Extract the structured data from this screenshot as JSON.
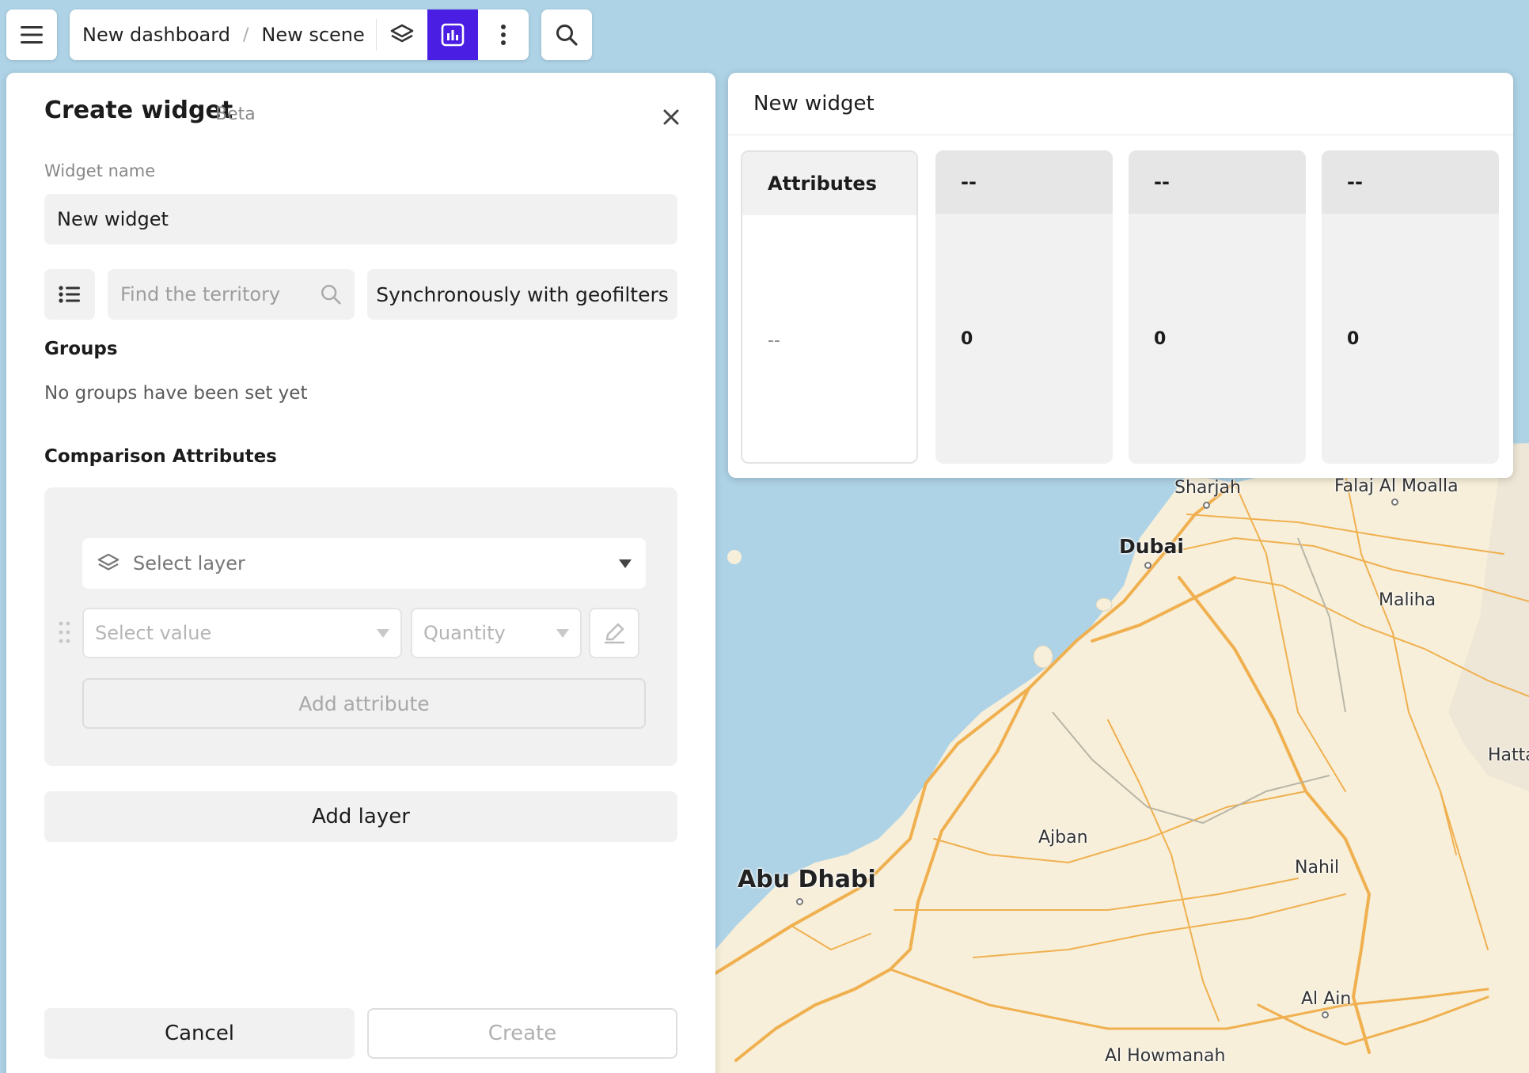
{
  "app": {
    "breadcrumb": {
      "dashboard": "New dashboard",
      "separator": "/",
      "scene": "New scene"
    },
    "accent_color": "#4b1ee3"
  },
  "icons": {
    "menu": "hamburger-menu-icon",
    "layers": "layers-icon",
    "widget": "chart-widget-icon",
    "more": "more-vertical-icon",
    "search": "search-icon",
    "close": "close-icon",
    "list": "list-icon",
    "edit": "pencil-icon",
    "drag": "drag-handle-icon"
  },
  "panel": {
    "title": "Create widget",
    "badge": "Beta",
    "widget_name_label": "Widget name",
    "widget_name_value": "New widget",
    "territory_placeholder": "Find the territory",
    "sync_button": "Synchronously with geofilters",
    "groups_title": "Groups",
    "groups_empty": "No groups have been set yet",
    "comparison_title": "Comparison Attributes",
    "layer_placeholder": "Select layer",
    "value_placeholder": "Select value",
    "quantity_placeholder": "Quantity",
    "add_attribute": "Add attribute",
    "add_layer": "Add layer",
    "cancel": "Cancel",
    "create": "Create"
  },
  "preview": {
    "title": "New widget",
    "columns": [
      {
        "header": "Attributes",
        "value": "--"
      },
      {
        "header": "--",
        "value": "0"
      },
      {
        "header": "--",
        "value": "0"
      },
      {
        "header": "--",
        "value": "0"
      }
    ]
  },
  "map": {
    "labels": {
      "sharjah": "Sharjah",
      "falaj": "Falaj Al Moalla",
      "dubai": "Dubai",
      "maliha": "Maliha",
      "hatta": "Hatta",
      "ajban": "Ajban",
      "nahil": "Nahil",
      "abu_dhabi": "Abu Dhabi",
      "al_ain": "Al Ain",
      "al_howmanah": "Al Howmanah"
    },
    "water_color": "#aed3e6",
    "land_color": "#f7efd9",
    "road_color": "#f0b050"
  }
}
